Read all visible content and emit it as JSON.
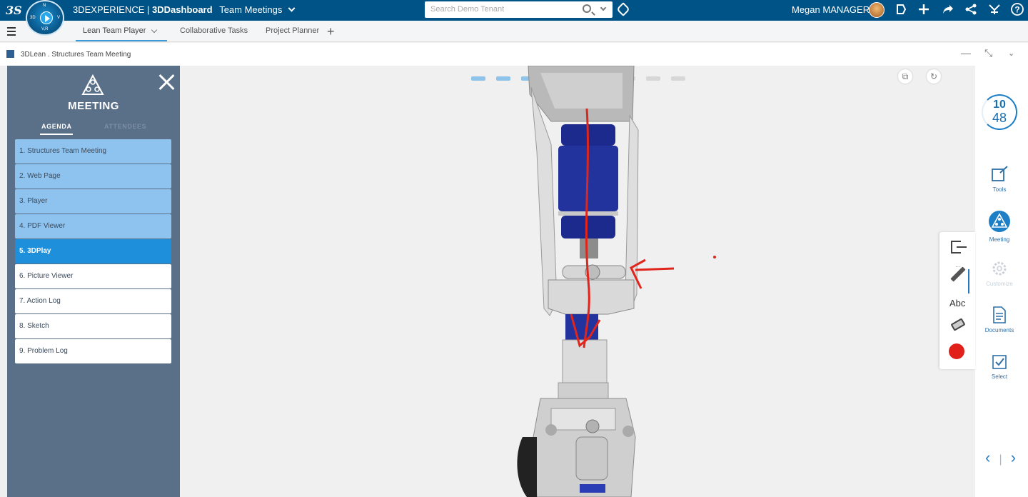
{
  "topbar": {
    "brand_light": "3DEXPERIENCE | ",
    "brand_bold": "3DDashboard",
    "dashboard_name": "Team Meetings",
    "search_placeholder": "Search Demo Tenant",
    "user_name": "Megan MANAGER",
    "compass_labels": [
      "N",
      "3D",
      "V",
      "V,R"
    ]
  },
  "tabs": [
    {
      "label": "Lean Team Player",
      "active": true
    },
    {
      "label": "Collaborative Tasks",
      "active": false
    },
    {
      "label": "Project Planner",
      "active": false
    }
  ],
  "widget": {
    "title": "3DLean . Structures Team Meeting"
  },
  "meeting_panel": {
    "title": "MEETING",
    "tab_agenda": "AGENDA",
    "tab_attendees": "ATTENDEES",
    "agenda": [
      {
        "label": "1. Structures Team Meeting",
        "state": "done"
      },
      {
        "label": "2. Web Page",
        "state": "done"
      },
      {
        "label": "3. Player",
        "state": "done"
      },
      {
        "label": "4. PDF Viewer",
        "state": "done"
      },
      {
        "label": "5. 3DPlay",
        "state": "current"
      },
      {
        "label": "6. Picture Viewer",
        "state": "todo"
      },
      {
        "label": "7. Action Log",
        "state": "todo"
      },
      {
        "label": "8. Sketch",
        "state": "todo"
      },
      {
        "label": "9. Problem Log",
        "state": "todo"
      }
    ]
  },
  "viewport": {
    "progress_total": 9,
    "progress_current": 5
  },
  "draw_toolbar": {
    "text_tool_label": "Abc",
    "record_color": "#e1201a"
  },
  "right_sidebar": {
    "timer_hours": "10",
    "timer_minutes": "48",
    "tools": [
      {
        "label": "Tools",
        "icon": "tools-icon",
        "enabled": true
      },
      {
        "label": "Meeting",
        "icon": "meeting-icon",
        "enabled": true
      },
      {
        "label": "Customize",
        "icon": "gear-icon",
        "enabled": false
      },
      {
        "label": "Documents",
        "icon": "document-icon",
        "enabled": true
      },
      {
        "label": "Select",
        "icon": "select-icon",
        "enabled": true
      }
    ]
  },
  "colors": {
    "topbar": "#005386",
    "panel": "#5a6f88",
    "agenda_done": "#8fc3ef",
    "agenda_current": "#1d8fdb",
    "accent": "#1a7fc6",
    "annotation": "#e0251c"
  }
}
